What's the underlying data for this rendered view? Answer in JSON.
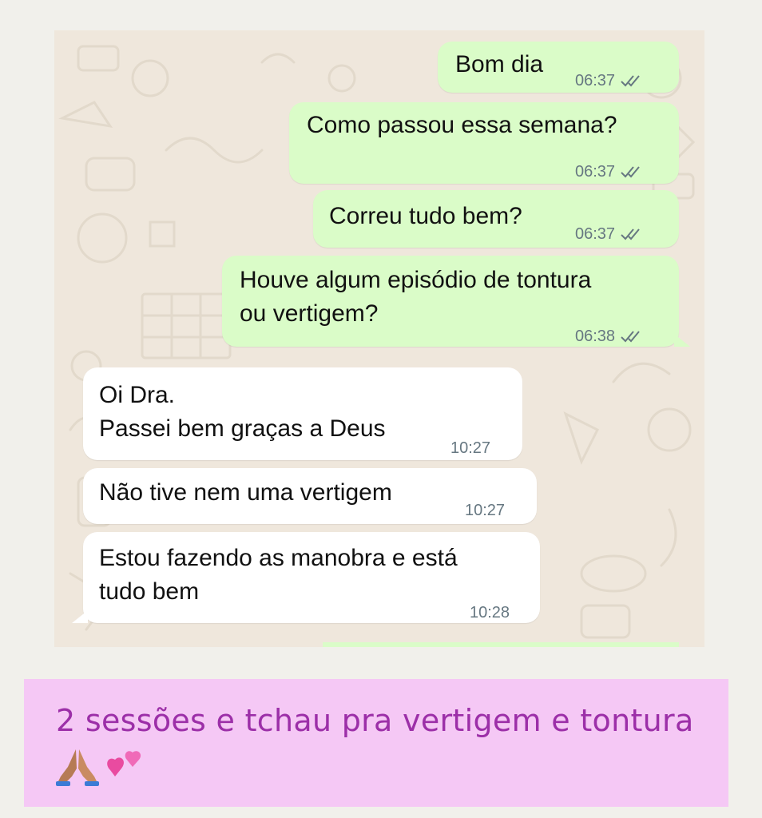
{
  "messages": [
    {
      "direction": "outgoing",
      "text": "Bom dia",
      "time": "06:37",
      "status": "read"
    },
    {
      "direction": "outgoing",
      "text": "Como passou essa semana?",
      "time": "06:37",
      "status": "read"
    },
    {
      "direction": "outgoing",
      "text": "Correu tudo bem?",
      "time": "06:37",
      "status": "read"
    },
    {
      "direction": "outgoing",
      "text": "Houve algum episódio de tontura\nou vertigem?",
      "time": "06:38",
      "status": "read"
    },
    {
      "direction": "incoming",
      "text": "Oi Dra.\nPassei bem graças a Deus",
      "time": "10:27"
    },
    {
      "direction": "incoming",
      "text": "Não tive nem uma vertigem",
      "time": "10:27"
    },
    {
      "direction": "incoming",
      "text": "Estou fazendo as manobra e está\ntudo bem",
      "time": "10:28"
    }
  ],
  "caption": {
    "text": "2 sessões e tchau pra vertigem e tontura",
    "emojis": [
      "folded-hands-icon",
      "two-hearts-icon"
    ]
  },
  "colors": {
    "outgoing_bubble": "#dafcc8",
    "incoming_bubble": "#ffffff",
    "chat_background": "#efe7dc",
    "caption_background": "#f5c8f5",
    "caption_text": "#9c2fa8",
    "read_ticks": "#667781"
  }
}
